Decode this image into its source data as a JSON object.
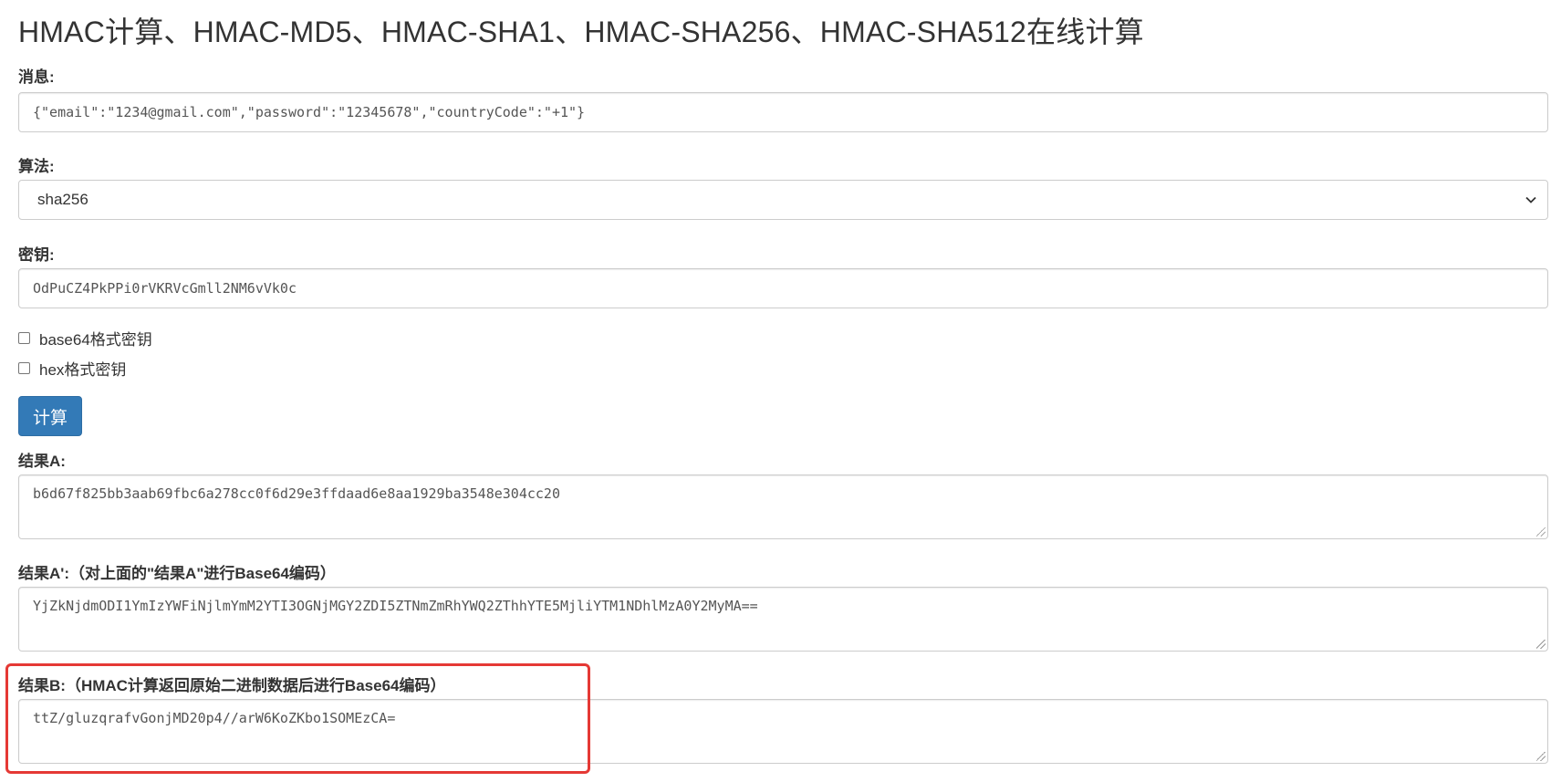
{
  "title": "HMAC计算、HMAC-MD5、HMAC-SHA1、HMAC-SHA256、HMAC-SHA512在线计算",
  "message": {
    "label": "消息:",
    "value": "{\"email\":\"1234@gmail.com\",\"password\":\"12345678\",\"countryCode\":\"+1\"}"
  },
  "algorithm": {
    "label": "算法:",
    "selected": "sha256"
  },
  "secret": {
    "label": "密钥:",
    "value": "OdPuCZ4PkPPi0rVKRVcGmll2NM6vVk0c"
  },
  "options": {
    "base64_label": "base64格式密钥",
    "base64_checked": false,
    "hex_label": "hex格式密钥",
    "hex_checked": false
  },
  "compute_button": "计算",
  "result_a": {
    "label": "结果A:",
    "value": "b6d67f825bb3aab69fbc6a278cc0f6d29e3ffdaad6e8aa1929ba3548e304cc20"
  },
  "result_a_base64": {
    "label": "结果A':（对上面的\"结果A\"进行Base64编码）",
    "value": "YjZkNjdmODI1YmIzYWFiNjlmYmM2YTI3OGNjMGY2ZDI5ZTNmZmRhYWQ2ZThhYTE5MjliYTM1NDhlMzA0Y2MyMA=="
  },
  "result_b": {
    "label": "结果B:（HMAC计算返回原始二进制数据后进行Base64编码）",
    "value": "ttZ/gluzqrafvGonjMD20p4//arW6KoZKbo1SOMEzCA="
  },
  "colors": {
    "primary_button": "#337ab7",
    "highlight": "#e53935"
  },
  "icons": {
    "select_arrow": "chevron-down-icon"
  }
}
